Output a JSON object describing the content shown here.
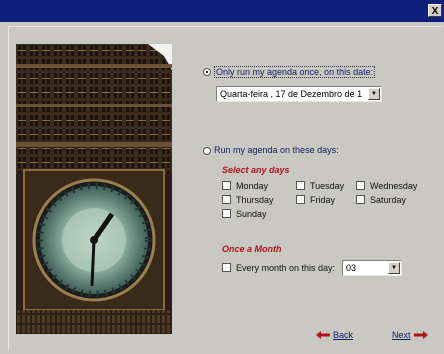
{
  "window": {
    "close_label": "X"
  },
  "schedule": {
    "once": {
      "label": "Only run my agenda once, on this date:",
      "selected": true,
      "date_value": "Quarta-feira , 17 de Dezembro de 1"
    },
    "days": {
      "label": "Run my agenda on these days:",
      "selected": false
    },
    "select_days_heading": "Select any days",
    "weekdays": [
      {
        "label": "Monday",
        "checked": false
      },
      {
        "label": "Tuesday",
        "checked": false
      },
      {
        "label": "Wednesday",
        "checked": false
      },
      {
        "label": "Thursday",
        "checked": false
      },
      {
        "label": "Friday",
        "checked": false
      },
      {
        "label": "Saturday",
        "checked": false
      },
      {
        "label": "Sunday",
        "checked": false
      }
    ],
    "monthly_heading": "Once a Month",
    "monthly": {
      "label": "Every month on this day:",
      "checked": false,
      "day_value": "03"
    }
  },
  "nav": {
    "back_label": "Back",
    "next_label": "Next"
  },
  "colors": {
    "titlebar": "#0d1e7c",
    "background": "#c9c8c2",
    "heading_red": "#b0151c",
    "link_navy": "#162066"
  }
}
